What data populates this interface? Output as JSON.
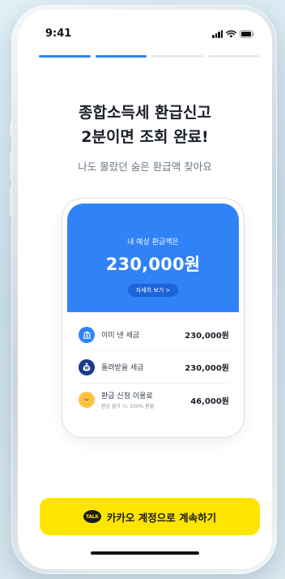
{
  "status_bar": {
    "time": "9:41"
  },
  "progress": {
    "step": 2,
    "total": 4
  },
  "heading": {
    "line1": "종합소득세 환급신고",
    "line2": "2분이면 조회 완료!"
  },
  "subheading": "나도 몰랐던 숨은 환급액 찾아요",
  "refund_card": {
    "label": "내 예상 환급액은",
    "amount": "230,000원",
    "detail_button": "자세히 보기 >"
  },
  "breakdown": [
    {
      "icon": "bank-icon",
      "label": "이미 낸 세금",
      "sub": "",
      "value": "230,000원",
      "color": "#3182f6"
    },
    {
      "icon": "money-bag-icon",
      "label": "돌려받을 세금",
      "sub": "",
      "value": "230,000원",
      "color": "#1b64da"
    },
    {
      "icon": "coin-icon",
      "label": "환급 신청 이용료",
      "sub": "환급 불가 시, 100% 환불",
      "value": "46,000원",
      "color": "#ffc342"
    }
  ],
  "cta": {
    "talk_badge": "TALK",
    "label": "카카오 계정으로 계속하기"
  },
  "colors": {
    "accent": "#3182f6",
    "kakao_yellow": "#fee500"
  }
}
